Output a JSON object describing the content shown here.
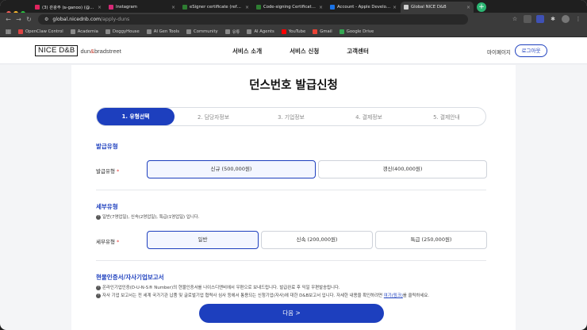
{
  "browser": {
    "tabs": [
      {
        "title": "(3) 관광주 (ผ-ganoo) (@hganoo",
        "color": "#e0245e",
        "active": false
      },
      {
        "title": "Instagram",
        "color": "#d62976",
        "active": false
      },
      {
        "title": "eSigner certificate (ref# co-",
        "color": "#2e7d32",
        "active": false
      },
      {
        "title": "Code-signing Certificate For",
        "color": "#2e7d32",
        "active": false
      },
      {
        "title": "Account - Apple Developer",
        "color": "#1a73e8",
        "active": false
      },
      {
        "title": "Global NICE D&B",
        "color": "#cfcfcf",
        "active": true
      }
    ],
    "new_tab_label": "+",
    "url_host": "global.nicednb.com",
    "url_path": "/apply-duns",
    "bookmarks": [
      {
        "label": "OpenClaw Control",
        "icon": "globe-icon",
        "color": "#d44"
      },
      {
        "label": "Academia",
        "icon": "folder-icon",
        "color": "#8a8a8a"
      },
      {
        "label": "DoggyHouse",
        "icon": "folder-icon",
        "color": "#8a8a8a"
      },
      {
        "label": "AI Gen Tools",
        "icon": "folder-icon",
        "color": "#8a8a8a"
      },
      {
        "label": "Community",
        "icon": "folder-icon",
        "color": "#8a8a8a"
      },
      {
        "label": "유튜",
        "icon": "folder-icon",
        "color": "#8a8a8a"
      },
      {
        "label": "AI Agents",
        "icon": "folder-icon",
        "color": "#8a8a8a"
      },
      {
        "label": "YouTube",
        "icon": "youtube-icon",
        "color": "#ff0000"
      },
      {
        "label": "Gmail",
        "icon": "gmail-icon",
        "color": "#ea4335"
      },
      {
        "label": "Google Drive",
        "icon": "drive-icon",
        "color": "#34a853"
      }
    ]
  },
  "site": {
    "logo_text": "NICE D&B",
    "logo_sub_a": "dun",
    "logo_sub_amp": "&",
    "logo_sub_b": "bradstreet",
    "nav": [
      "서비스 소개",
      "서비스 신청",
      "고객센터"
    ],
    "mypage": "마이페이지",
    "logout": "로그아웃"
  },
  "page": {
    "title": "던스번호 발급신청",
    "steps": [
      {
        "label": "1. 유형선택",
        "active": true
      },
      {
        "label": "2. 담당자정보",
        "active": false
      },
      {
        "label": "3. 기업정보",
        "active": false
      },
      {
        "label": "4. 결제정보",
        "active": false
      },
      {
        "label": "5. 결제안내",
        "active": false
      }
    ],
    "issue_section": "발급유형",
    "issue_label": "발급유형",
    "required_mark": "*",
    "issue_options": [
      {
        "label": "신규 (500,000원)",
        "selected": true
      },
      {
        "label": "갱신(400,000원)",
        "selected": false
      }
    ],
    "detail_section": "세부유형",
    "detail_hint": "일반(7영업일), 신속(2영업일), 특급(1영업일) 입니다.",
    "detail_label": "세부유형",
    "detail_options": [
      {
        "label": "일반",
        "selected": true
      },
      {
        "label": "신속 (200,000원)",
        "selected": false
      },
      {
        "label": "특급 (250,000원)",
        "selected": false
      }
    ],
    "report_section": "현물인증서/자사기업보고서",
    "note1": "온라인기업인증(D-U-N-S® Number)의 현물인증서를 나이스디앤비에서 우편으로 보내드립니다. 발급완료 후 익일 우편발송됩니다.",
    "note2_pre": "자사 기업 보고서는 전 세계 국가기관 납품 및 글로벌기업 협력사 심사 등에서 통용되는 신청기업(자사)에 대한 D&B보고서 입니다. 자세한 내용을 확인하려면 ",
    "note2_link": "여기(링크)",
    "note2_post": "를 클릭하세요.",
    "next_button": "다음 >"
  },
  "colors": {
    "brand": "#1d3fbe",
    "required": "#e53935"
  }
}
